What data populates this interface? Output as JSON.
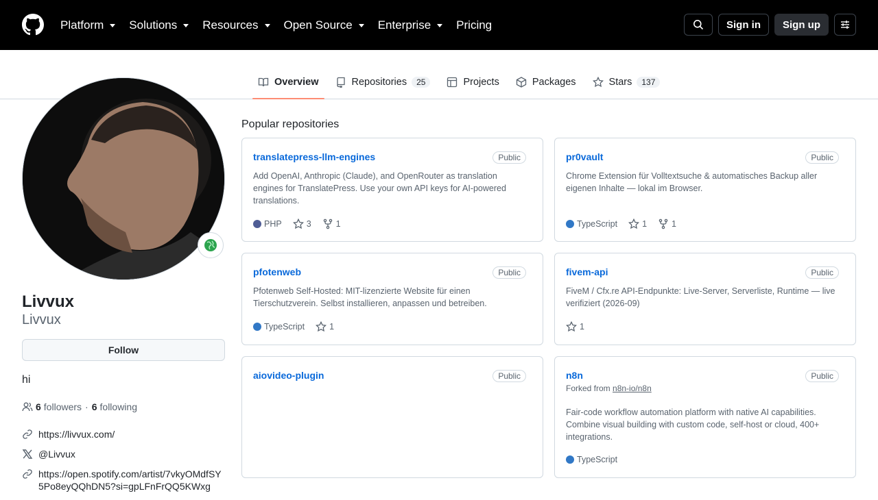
{
  "header": {
    "nav": [
      "Platform",
      "Solutions",
      "Resources",
      "Open Source",
      "Enterprise",
      "Pricing"
    ],
    "sign_in": "Sign in",
    "sign_up": "Sign up"
  },
  "tabs": {
    "overview": "Overview",
    "repositories": "Repositories",
    "repositories_count": "25",
    "projects": "Projects",
    "packages": "Packages",
    "stars": "Stars",
    "stars_count": "137"
  },
  "profile": {
    "name": "Livvux",
    "login": "Livvux",
    "follow": "Follow",
    "bio": "hi",
    "followers_count": "6",
    "followers_label": "followers",
    "sep": "·",
    "following_count": "6",
    "following_label": "following",
    "website": "https://livvux.com/",
    "twitter": "@Livvux",
    "spotify": "https://open.spotify.com/artist/7vkyOMdfSY5Po8eyQQhDN5?si=gpLFnFrQQ5KWxg"
  },
  "popular": {
    "heading": "Popular repositories",
    "colors": {
      "php": "#4F5D95",
      "typescript": "#3178c6"
    },
    "repos": [
      {
        "name": "translatepress-llm-engines",
        "visibility": "Public",
        "description": "Add OpenAI, Anthropic (Claude), and OpenRouter as translation engines for TranslatePress. Use your own API keys for AI-powered translations.",
        "language": "PHP",
        "stars": "3",
        "forks": "1"
      },
      {
        "name": "pr0vault",
        "visibility": "Public",
        "description": "Chrome Extension für Volltextsuche & automatisches Backup aller eigenen Inhalte — lokal im Browser.",
        "language": "TypeScript",
        "stars": "1",
        "forks": "1"
      },
      {
        "name": "pfotenweb",
        "visibility": "Public",
        "description": "Pfotenweb Self-Hosted: MIT-lizenzierte Website für einen Tierschutzverein. Selbst installieren, anpassen und betreiben.",
        "language": "TypeScript",
        "stars": "1"
      },
      {
        "name": "fivem-api",
        "visibility": "Public",
        "description": "FiveM / Cfx.re API-Endpunkte: Live-Server, Serverliste, Runtime — live verifiziert (2026-09)",
        "stars": "1"
      },
      {
        "name": "aiovideo-plugin",
        "visibility": "Public"
      },
      {
        "name": "n8n",
        "visibility": "Public",
        "forked_prefix": "Forked from",
        "forked_from": "n8n-io/n8n",
        "description": "Fair-code workflow automation platform with native AI capabilities. Combine visual building with custom code, self-host or cloud, 400+ integrations.",
        "language": "TypeScript"
      }
    ]
  }
}
